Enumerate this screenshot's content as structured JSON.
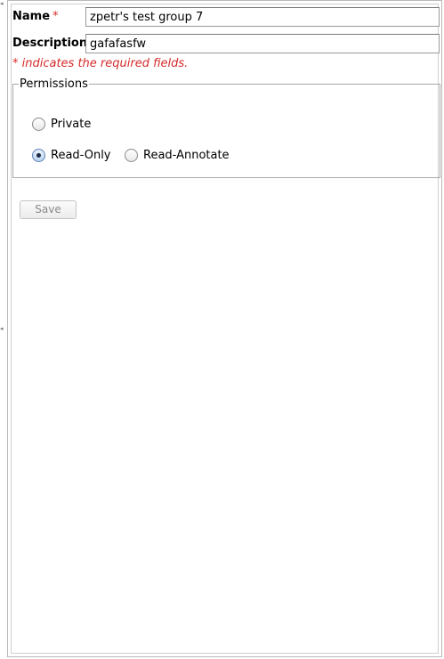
{
  "form": {
    "name_label": "Name",
    "description_label": "Description",
    "required_star": "*",
    "name_value": "zpetr's test group 7",
    "description_value": "gafafasfw",
    "required_note": "* indicates the required fields."
  },
  "permissions": {
    "legend": "Permissions",
    "options": [
      {
        "label": "Private",
        "checked": false
      },
      {
        "label": "Read-Only",
        "checked": true
      },
      {
        "label": "Read-Annotate",
        "checked": false
      }
    ]
  },
  "actions": {
    "save_label": "Save",
    "save_enabled": false
  },
  "colors": {
    "required": "#d62a2a",
    "radio_selected": "#5a83b8",
    "border": "#a9a9a9"
  }
}
